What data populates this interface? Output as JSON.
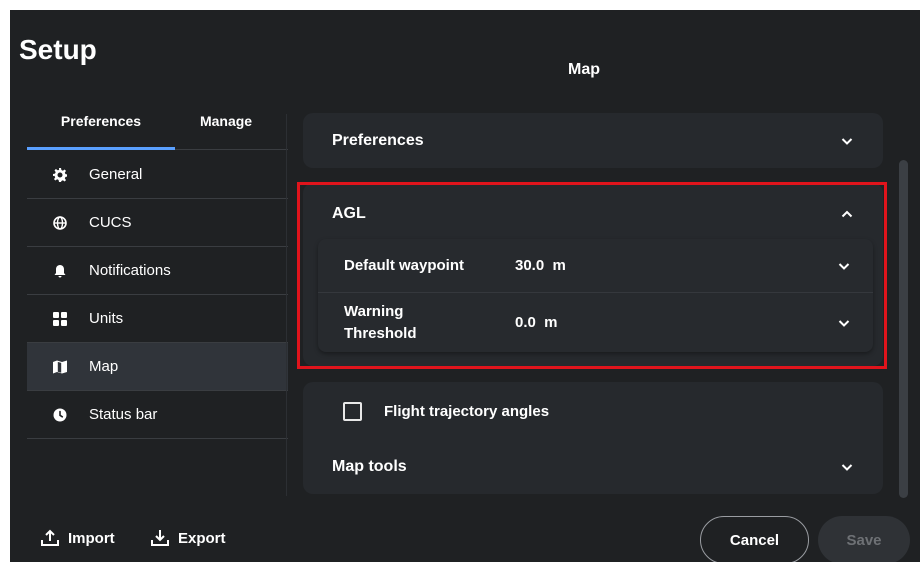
{
  "app_title": "Setup",
  "page_title": "Map",
  "tabs": [
    {
      "label": "Preferences",
      "selected": true
    },
    {
      "label": "Manage",
      "selected": false
    }
  ],
  "nav": [
    {
      "label": "General",
      "icon": "gear-icon"
    },
    {
      "label": "CUCS",
      "icon": "globe-icon"
    },
    {
      "label": "Notifications",
      "icon": "bell-icon"
    },
    {
      "label": "Units",
      "icon": "grid-icon"
    },
    {
      "label": "Map",
      "icon": "map-icon",
      "active": true
    },
    {
      "label": "Status bar",
      "icon": "clock-icon"
    }
  ],
  "sections": {
    "preferences": {
      "label": "Preferences"
    },
    "agl": {
      "label": "AGL",
      "rows": [
        {
          "label": "Default waypoint",
          "value": "30.0  m"
        },
        {
          "label_line1": "Warning",
          "label_line2": "Threshold",
          "value": "0.0  m"
        }
      ]
    },
    "flight_trajectory": {
      "label": "Flight trajectory angles",
      "checked": false
    },
    "map_tools": {
      "label": "Map tools"
    }
  },
  "footer": {
    "import_label": "Import",
    "export_label": "Export",
    "cancel_label": "Cancel",
    "save_label": "Save"
  },
  "colors": {
    "background": "#1f2123",
    "card": "#26292d",
    "accent": "#5aa0ff",
    "highlight": "#e0141c"
  }
}
